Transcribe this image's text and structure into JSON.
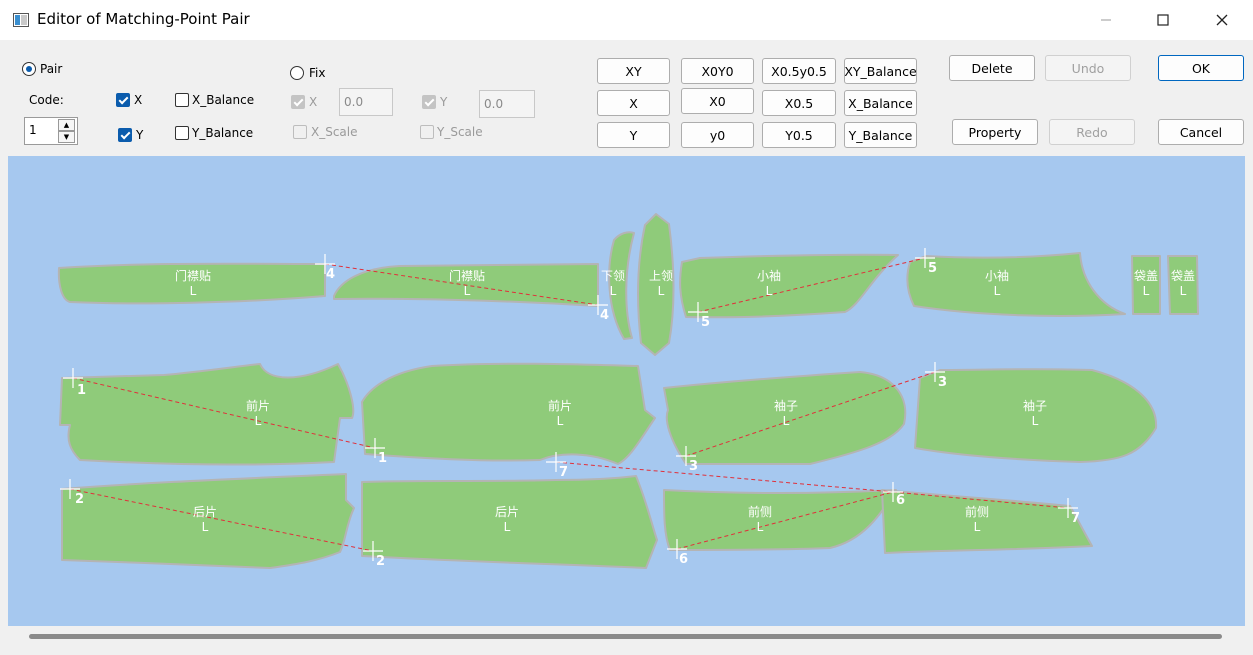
{
  "window": {
    "title": "Editor of Matching-Point Pair"
  },
  "controls": {
    "pair_label": "Pair",
    "fix_label": "Fix",
    "code_label": "Code:",
    "code_value": "1",
    "x_label": "X",
    "y_label": "Y",
    "x_balance_label": "X_Balance",
    "y_balance_label": "Y_Balance",
    "fix_x_label": "X",
    "fix_y_label": "Y",
    "fix_x_value": "0.0",
    "fix_y_value": "0.0",
    "x_scale_label": "X_Scale",
    "y_scale_label": "Y_Scale"
  },
  "buttons": {
    "xy": "XY",
    "x0y0": "X0Y0",
    "x05y05": "X0.5y0.5",
    "xy_balance": "XY_Balance",
    "x": "X",
    "x0": "X0",
    "x05": "X0.5",
    "x_balance": "X_Balance",
    "y": "Y",
    "y0": "y0",
    "y05": "Y0.5",
    "y_balance": "Y_Balance",
    "delete": "Delete",
    "undo": "Undo",
    "ok": "OK",
    "property": "Property",
    "redo": "Redo",
    "cancel": "Cancel"
  },
  "pieces": [
    {
      "name": "门襟贴",
      "size": "L"
    },
    {
      "name": "门襟贴",
      "size": "L"
    },
    {
      "name": "下领",
      "size": "L"
    },
    {
      "name": "上领",
      "size": "L"
    },
    {
      "name": "小袖",
      "size": "L"
    },
    {
      "name": "小袖",
      "size": "L"
    },
    {
      "name": "袋盖",
      "size": "L"
    },
    {
      "name": "袋盖",
      "size": "L"
    },
    {
      "name": "前片",
      "size": "L"
    },
    {
      "name": "前片",
      "size": "L"
    },
    {
      "name": "袖子",
      "size": "L"
    },
    {
      "name": "袖子",
      "size": "L"
    },
    {
      "name": "后片",
      "size": "L"
    },
    {
      "name": "后片",
      "size": "L"
    },
    {
      "name": "前侧",
      "size": "L"
    },
    {
      "name": "前侧",
      "size": "L"
    }
  ],
  "pair_numbers": [
    "4",
    "4",
    "5",
    "5",
    "1",
    "1",
    "3",
    "3",
    "7",
    "7",
    "2",
    "2",
    "6",
    "6"
  ],
  "colors": {
    "canvas": "#a6c8ef",
    "piece_fill": "#8fcb7a",
    "piece_stroke": "#b4b4b4",
    "pair_line": "#e0303a",
    "accent": "#0b5cad"
  }
}
